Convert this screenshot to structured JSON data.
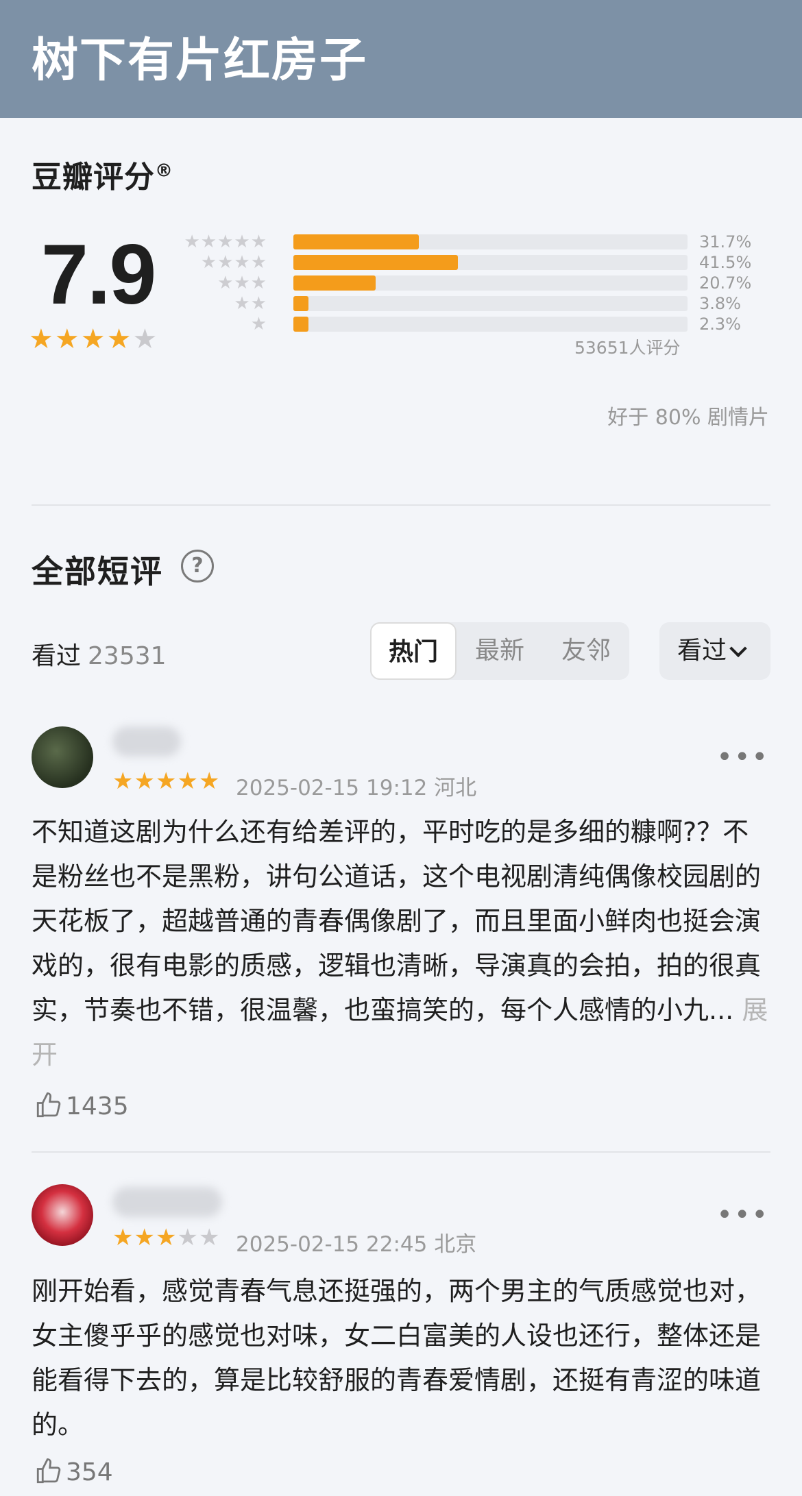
{
  "header": {
    "title": "树下有片红房子"
  },
  "rating": {
    "section_title": "豆瓣评分",
    "registered_mark": "®",
    "score": "7.9",
    "score_stars": 4,
    "distribution": [
      {
        "stars": 5,
        "percent": 31.7,
        "label": "31.7%"
      },
      {
        "stars": 4,
        "percent": 41.5,
        "label": "41.5%"
      },
      {
        "stars": 3,
        "percent": 20.7,
        "label": "20.7%"
      },
      {
        "stars": 2,
        "percent": 3.8,
        "label": "3.8%"
      },
      {
        "stars": 1,
        "percent": 2.3,
        "label": "2.3%"
      }
    ],
    "count_label": "53651人评分",
    "better_than": "好于 80% 剧情片"
  },
  "reviews_section": {
    "title": "全部短评",
    "seen_label": "看过",
    "seen_count": "23531",
    "tabs": [
      "热门",
      "最新",
      "友邻"
    ],
    "active_tab": "热门",
    "filter_label": "看过"
  },
  "reviews": [
    {
      "stars": 5,
      "meta": "2025-02-15 19:12 河北",
      "text": "不知道这剧为什么还有给差评的，平时吃的是多细的糠啊?？不是粉丝也不是黑粉，讲句公道话，这个电视剧清纯偶像校园剧的天花板了，超越普通的青春偶像剧了，而且里面小鲜肉也挺会演戏的，很有电影的质感，逻辑也清晰，导演真的会拍，拍的很真实，节奏也不错，很温馨，也蛮搞笑的，每个人感情的小九...",
      "expand_label": "展开",
      "likes": "1435"
    },
    {
      "stars": 3,
      "meta": "2025-02-15 22:45 北京",
      "text": "刚开始看，感觉青春气息还挺强的，两个男主的气质感觉也对，女主傻乎乎的感觉也对味，女二白富美的人设也还行，整体还是能看得下去的，算是比较舒服的青春爱情剧，还挺有青涩的味道的。",
      "likes": "354"
    }
  ],
  "colors": {
    "header_bg": "#7d91a6",
    "star": "#f5a623",
    "bar": "#f49c1b"
  },
  "icons": [
    "help-icon",
    "chevron-down-icon",
    "more-icon",
    "thumbs-up-icon",
    "star-icon"
  ]
}
